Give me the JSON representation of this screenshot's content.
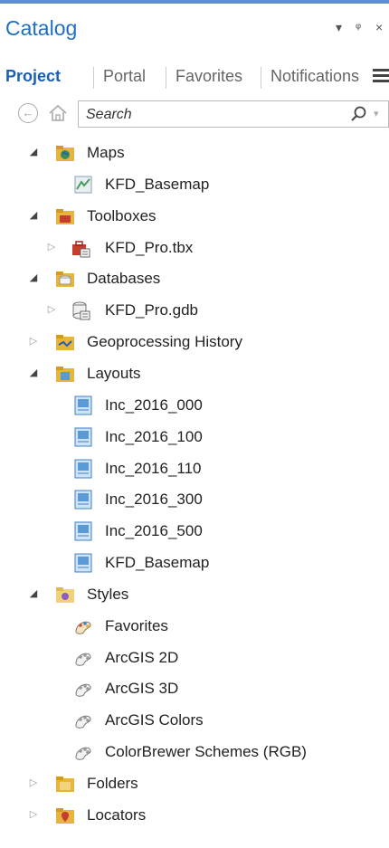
{
  "pane": {
    "title": "Catalog",
    "controls": {
      "dropdown": "▾",
      "pin": "ᵠ",
      "close": "×"
    }
  },
  "tabs": [
    {
      "label": "Project",
      "active": true
    },
    {
      "label": "Portal",
      "active": false
    },
    {
      "label": "Favorites",
      "active": false
    },
    {
      "label": "Notifications",
      "active": false
    }
  ],
  "search": {
    "placeholder": "Search",
    "value": ""
  },
  "colors": {
    "accent": "#1f6ec2",
    "top_line": "#5b8ed6",
    "active_tab": "#1a5fb4"
  },
  "tree": [
    {
      "label": "Maps",
      "icon": "maps-folder-icon",
      "expanded": true
    },
    {
      "label": "KFD_Basemap",
      "icon": "map-icon"
    },
    {
      "label": "Toolboxes",
      "icon": "toolboxes-folder-icon",
      "expanded": true
    },
    {
      "label": "KFD_Pro.tbx",
      "icon": "toolbox-icon",
      "expanded": false
    },
    {
      "label": "Databases",
      "icon": "databases-folder-icon",
      "expanded": true
    },
    {
      "label": "KFD_Pro.gdb",
      "icon": "geodatabase-icon",
      "expanded": false
    },
    {
      "label": "Geoprocessing History",
      "icon": "geoprocessing-history-icon",
      "expanded": false
    },
    {
      "label": "Layouts",
      "icon": "layouts-folder-icon",
      "expanded": true
    },
    {
      "label": "Inc_2016_000",
      "icon": "layout-icon"
    },
    {
      "label": "Inc_2016_100",
      "icon": "layout-icon"
    },
    {
      "label": "Inc_2016_110",
      "icon": "layout-icon"
    },
    {
      "label": "Inc_2016_300",
      "icon": "layout-icon"
    },
    {
      "label": "Inc_2016_500",
      "icon": "layout-icon"
    },
    {
      "label": "KFD_Basemap",
      "icon": "layout-icon"
    },
    {
      "label": "Styles",
      "icon": "styles-folder-icon",
      "expanded": true
    },
    {
      "label": "Favorites",
      "icon": "favorites-style-icon"
    },
    {
      "label": "ArcGIS 2D",
      "icon": "style-icon"
    },
    {
      "label": "ArcGIS 3D",
      "icon": "style-icon"
    },
    {
      "label": "ArcGIS Colors",
      "icon": "style-icon"
    },
    {
      "label": "ColorBrewer Schemes (RGB)",
      "icon": "style-icon"
    },
    {
      "label": "Folders",
      "icon": "folders-icon",
      "expanded": false
    },
    {
      "label": "Locators",
      "icon": "locators-icon",
      "expanded": false
    }
  ]
}
